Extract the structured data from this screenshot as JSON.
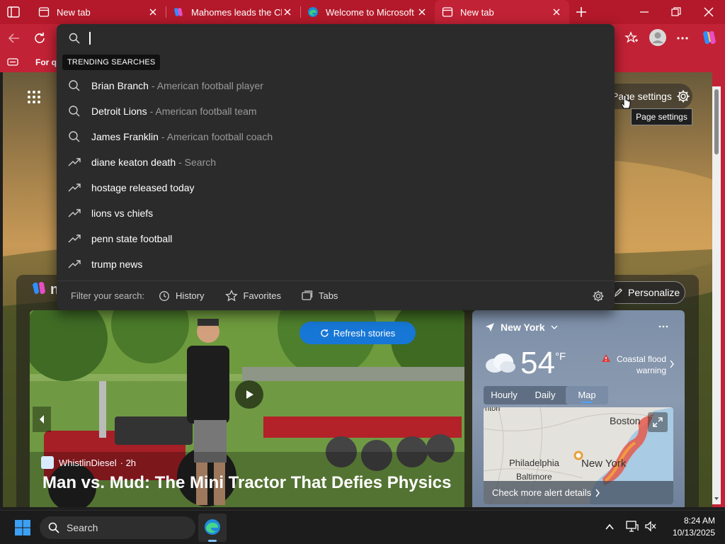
{
  "colors": {
    "accent": "#c22235",
    "title_bar": "#b3192a",
    "dropdown_bg": "#2b2b2b",
    "refresh_button": "#1777d6",
    "taskbar": "#1c1c1c"
  },
  "tabs": [
    {
      "title": "New tab",
      "icon": "newtab-icon",
      "active": false
    },
    {
      "title": "Mahomes leads the Chie",
      "icon": "copilot-icon",
      "active": false
    },
    {
      "title": "Welcome to Microsoft E",
      "icon": "edge-icon",
      "active": false
    },
    {
      "title": "New tab",
      "icon": "newtab-icon",
      "active": true
    }
  ],
  "favorites_bar": {
    "label": "For qu"
  },
  "omnibox": {
    "value": ""
  },
  "dropdown": {
    "section_label": "TRENDING SEARCHES",
    "suggestions": [
      {
        "text": "Brian Branch",
        "sub": "- American football player",
        "icon": "search-icon"
      },
      {
        "text": "Detroit Lions",
        "sub": "- American football team",
        "icon": "search-icon"
      },
      {
        "text": "James Franklin",
        "sub": "- American football coach",
        "icon": "search-icon"
      },
      {
        "text": "diane keaton death",
        "sub": "- Search",
        "icon": "trending-icon"
      },
      {
        "text": "hostage released today",
        "sub": "",
        "icon": "trending-icon"
      },
      {
        "text": "lions vs chiefs",
        "sub": "",
        "icon": "trending-icon"
      },
      {
        "text": "penn state football",
        "sub": "",
        "icon": "trending-icon"
      },
      {
        "text": "trump news",
        "sub": "",
        "icon": "trending-icon"
      }
    ],
    "filter": {
      "label": "Filter your search:",
      "history": "History",
      "favorites": "Favorites",
      "tabs": "Tabs"
    }
  },
  "page": {
    "page_settings_label": "Page settings",
    "page_settings_tooltip": "Page settings",
    "brand_fragment": "n",
    "personalize_label": "Personalize",
    "refresh_stories_label": "Refresh stories",
    "story": {
      "source": "WhistlinDiesel",
      "age": "· 2h",
      "headline": "Man vs. Mud: The Mini Tractor That Defies Physics"
    },
    "weather": {
      "location": "New York",
      "temperature": "54",
      "unit": "°F",
      "alert_line1": "Coastal flood",
      "alert_line2": "warning",
      "tabs": [
        "Hourly",
        "Daily",
        "Map"
      ],
      "selected_tab": "Map",
      "map_labels": {
        "top_left": "nton",
        "boston": "Boston",
        "philadelphia": "Philadelphia",
        "baltimore": "Baltimore",
        "new_york": "New York"
      },
      "alert_link": "Check more alert details"
    }
  },
  "taskbar": {
    "search_label": "Search",
    "time": "8:24 AM",
    "date": "10/13/2025"
  }
}
